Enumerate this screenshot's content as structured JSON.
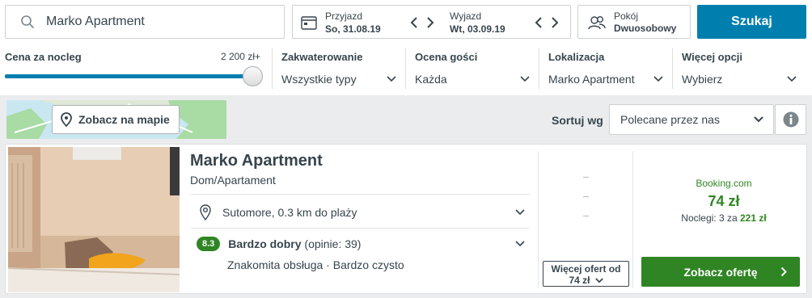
{
  "search": {
    "value": "Marko Apartment",
    "button_label": "Szukaj"
  },
  "dates": {
    "checkin_label": "Przyjazd",
    "checkin_value": "So, 31.08.19",
    "checkout_label": "Wyjazd",
    "checkout_value": "Wt, 03.09.19"
  },
  "rooms": {
    "label": "Pokój",
    "value": "Dwuosobowy"
  },
  "filters": {
    "price_label": "Cena za nocleg",
    "price_max": "2 200 zł+",
    "price_fill_percent": 100,
    "accommodation_label": "Zakwaterowanie",
    "accommodation_value": "Wszystkie typy",
    "rating_label": "Ocena gości",
    "rating_value": "Każda",
    "location_label": "Lokalizacja",
    "location_value": "Marko Apartment",
    "more_label": "Więcej opcji",
    "more_value": "Wybierz"
  },
  "map": {
    "button_label": "Zobacz na mapie"
  },
  "sort": {
    "label": "Sortuj wg",
    "value": "Polecane przez nas"
  },
  "hotel": {
    "name": "Marko Apartment",
    "type": "Dom/Apartament",
    "location": "Sutomore, 0.3 km do plaży",
    "rating_score": "8.3",
    "rating_word": "Bardzo dobry",
    "rating_count": "(opinie: 39)",
    "highlights": "Znakomita obsługa · Bardzo czysto",
    "more_offers": "Więcej ofert od",
    "more_offers_price": "74 zł",
    "provider": "Booking.com",
    "price": "74 zł",
    "nights_prefix": "Noclegi: 3 za",
    "nights_total": "221 zł",
    "offer_button": "Zobacz ofertę"
  },
  "colors": {
    "accent": "#007faf",
    "green": "#2f8523",
    "text": "#37454d"
  }
}
